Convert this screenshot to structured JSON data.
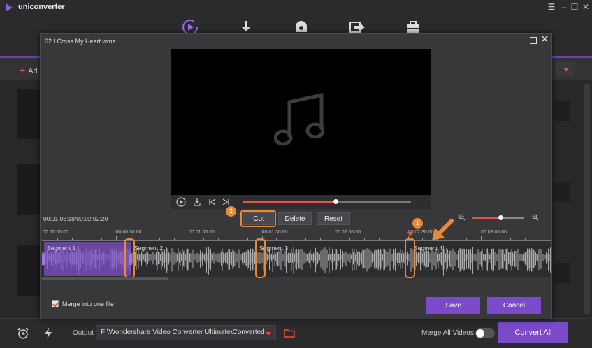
{
  "app": {
    "title": "uniconverter",
    "logo_color": "#8e5fd8",
    "accent": "#7a4ac8",
    "highlight": "#e8893a"
  },
  "nav": {
    "items": [
      "convert-icon",
      "download-icon",
      "record-icon",
      "transfer-icon",
      "toolbox-icon"
    ],
    "active": "convert-icon"
  },
  "toolbar": {
    "add_files_label": "Ad"
  },
  "dialog": {
    "title": "02 I Cross My Heart.wma",
    "time_readout": "00:01:03:18/00:02:02:20",
    "playback_progress": 0.55,
    "zoom_level": 0.55,
    "buttons": {
      "cut": "Cut",
      "delete": "Delete",
      "reset": "Reset",
      "save": "Save",
      "cancel": "Cancel"
    },
    "callouts": [
      "1",
      "2"
    ],
    "ruler_ticks": [
      "00:00:00:00",
      "00:00:30:00",
      "00:01:00:00",
      "00:01:30:00",
      "00:02:00:00",
      "00:02:30:00",
      "00:03:00:00"
    ],
    "segments": [
      "Segment 1",
      "Segment 2",
      "Segment 3",
      "Segment 4"
    ],
    "merge_label": "Merge into one file",
    "merge_checked": true
  },
  "bottom": {
    "output_label": "Output",
    "output_path": "F:\\Wondershare Video Converter Ultimate\\Converted",
    "merge_all_label": "Merge All Videos",
    "merge_all_on": false,
    "convert_all_label": "Convert All"
  }
}
